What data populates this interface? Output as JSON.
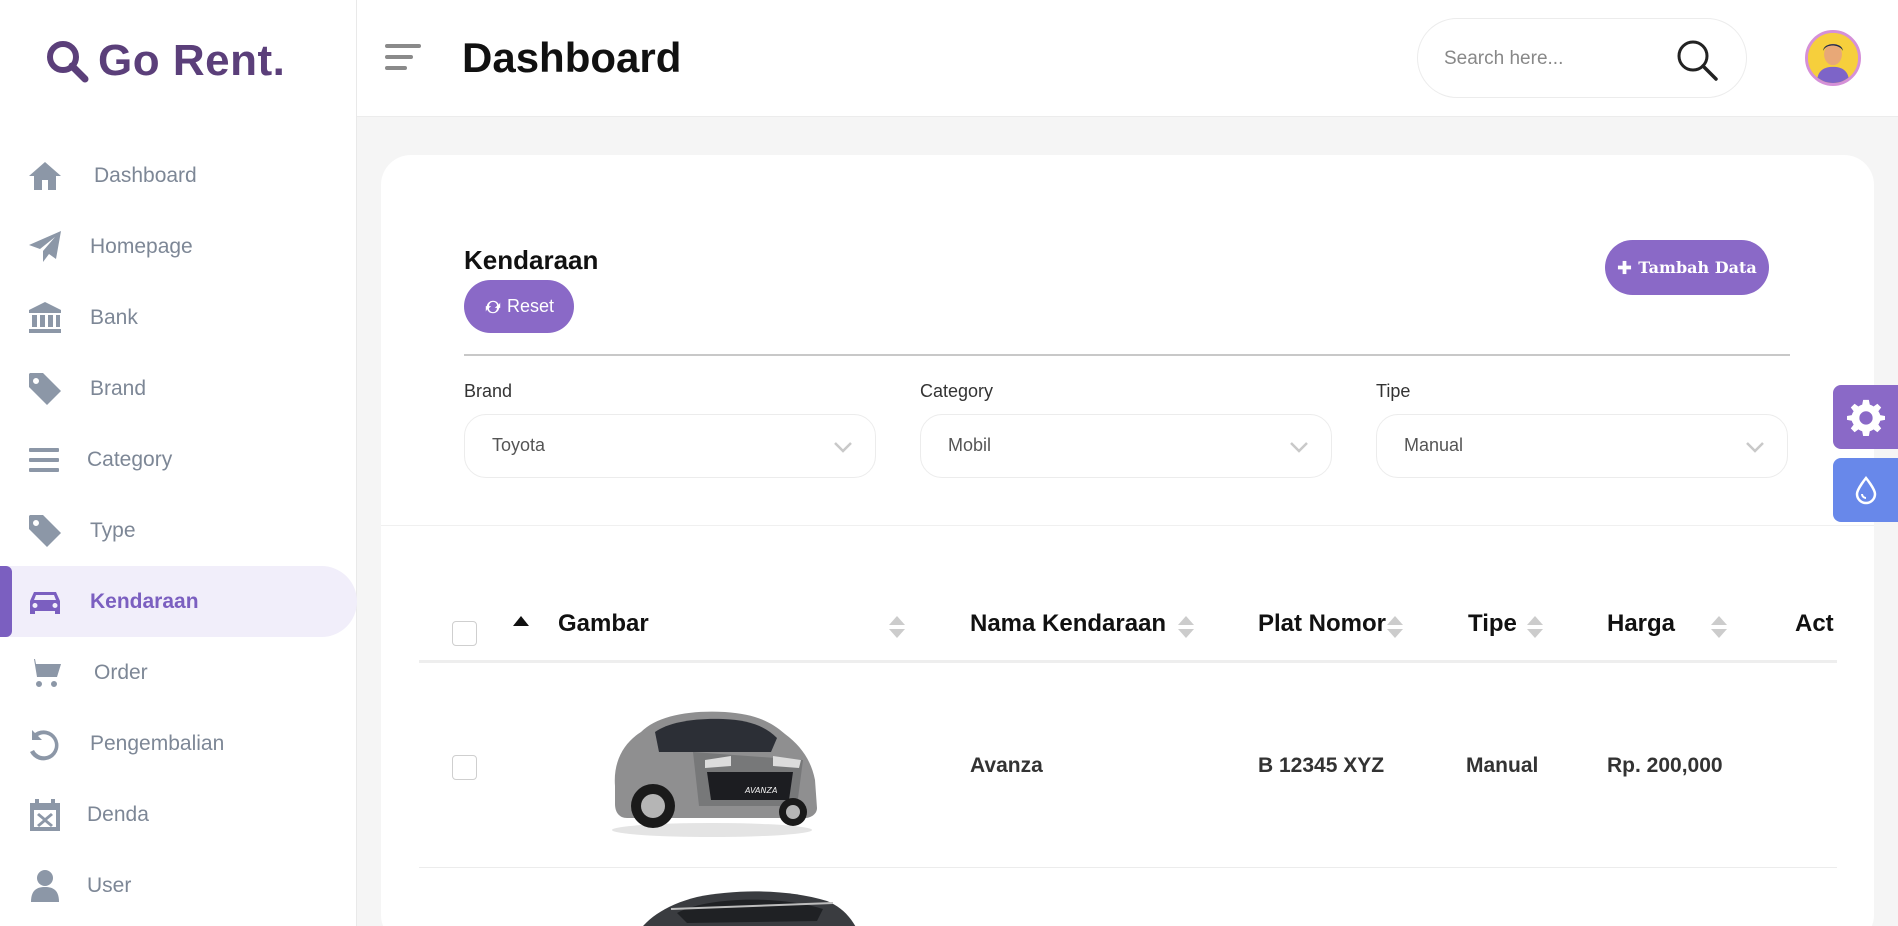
{
  "app": {
    "name": "Go Rent."
  },
  "sidebar": {
    "items": [
      {
        "label": "Dashboard",
        "icon": "home-icon",
        "active": false
      },
      {
        "label": "Homepage",
        "icon": "paper-plane-icon",
        "active": false
      },
      {
        "label": "Bank",
        "icon": "bank-icon",
        "active": false
      },
      {
        "label": "Brand",
        "icon": "tag-icon",
        "active": false
      },
      {
        "label": "Category",
        "icon": "list-icon",
        "active": false
      },
      {
        "label": "Type",
        "icon": "tag-icon",
        "active": false
      },
      {
        "label": "Kendaraan",
        "icon": "car-icon",
        "active": true
      },
      {
        "label": "Order",
        "icon": "cart-icon",
        "active": false
      },
      {
        "label": "Pengembalian",
        "icon": "undo-icon",
        "active": false
      },
      {
        "label": "Denda",
        "icon": "calendar-x-icon",
        "active": false
      },
      {
        "label": "User",
        "icon": "user-icon",
        "active": false
      }
    ]
  },
  "header": {
    "title": "Dashboard",
    "search_placeholder": "Search here..."
  },
  "card": {
    "title": "Kendaraan",
    "reset_label": "Reset",
    "add_label": "Tambah Data"
  },
  "filters": [
    {
      "label": "Brand",
      "value": "Toyota"
    },
    {
      "label": "Category",
      "value": "Mobil"
    },
    {
      "label": "Tipe",
      "value": "Manual"
    }
  ],
  "table": {
    "columns": [
      "Gambar",
      "Nama Kendaraan",
      "Plat Nomor",
      "Tipe",
      "Harga",
      "Act"
    ],
    "rows": [
      {
        "nama": "Avanza",
        "plat": "B 12345 XYZ",
        "tipe": "Manual",
        "harga": "Rp. 200,000",
        "car_badge": "AVANZA"
      },
      {
        "nama": "",
        "plat": "",
        "tipe": "",
        "harga": ""
      }
    ]
  },
  "colors": {
    "accent": "#8a69c7",
    "brand": "#5b3f7a",
    "secondary": "#6888ea"
  }
}
